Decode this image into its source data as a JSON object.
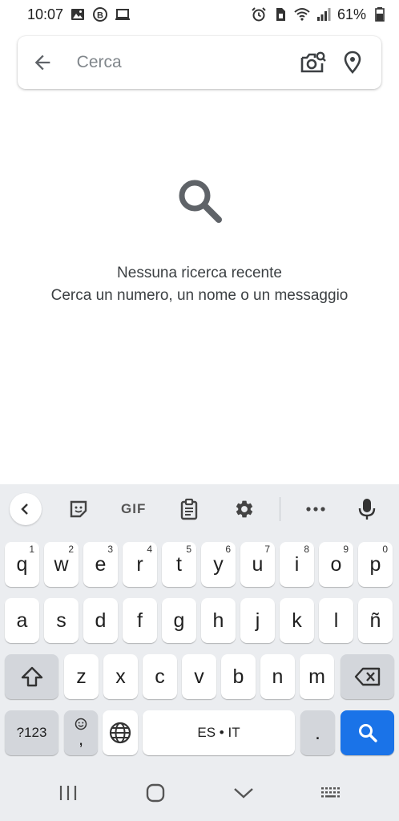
{
  "status_bar": {
    "time": "10:07",
    "battery": "61%",
    "left_icons": [
      "image-icon",
      "b-badge-icon",
      "laptop-icon"
    ],
    "right_icons": [
      "alarm-icon",
      "sim-icon",
      "wifi-icon",
      "signal-icon",
      "battery-icon"
    ]
  },
  "search": {
    "placeholder": "Cerca",
    "value": "",
    "icons": [
      "back-arrow-icon",
      "camera-search-icon",
      "location-pin-icon"
    ]
  },
  "empty_state": {
    "icon": "search-icon",
    "title": "Nessuna ricerca recente",
    "subtitle": "Cerca un numero, un nome o un messaggio"
  },
  "keyboard": {
    "toolbar": {
      "gif_label": "GIF",
      "icons": [
        "chevron-left-icon",
        "sticker-icon",
        "gif-icon",
        "clipboard-icon",
        "settings-icon",
        "more-icon",
        "mic-icon"
      ]
    },
    "row1": [
      {
        "label": "q",
        "sup": "1"
      },
      {
        "label": "w",
        "sup": "2"
      },
      {
        "label": "e",
        "sup": "3"
      },
      {
        "label": "r",
        "sup": "4"
      },
      {
        "label": "t",
        "sup": "5"
      },
      {
        "label": "y",
        "sup": "6"
      },
      {
        "label": "u",
        "sup": "7"
      },
      {
        "label": "i",
        "sup": "8"
      },
      {
        "label": "o",
        "sup": "9"
      },
      {
        "label": "p",
        "sup": "0"
      }
    ],
    "row2": [
      "a",
      "s",
      "d",
      "f",
      "g",
      "h",
      "j",
      "k",
      "l",
      "ñ"
    ],
    "row3": [
      "z",
      "x",
      "c",
      "v",
      "b",
      "n",
      "m"
    ],
    "symbols_label": "?123",
    "emoji_comma": ",",
    "space_label": "ES • IT",
    "period_label": ".",
    "accent_color": "#1a73e8"
  },
  "nav_bar": {
    "icons": [
      "recents-icon",
      "home-icon",
      "back-chevron-icon",
      "keyboard-switch-icon"
    ]
  }
}
